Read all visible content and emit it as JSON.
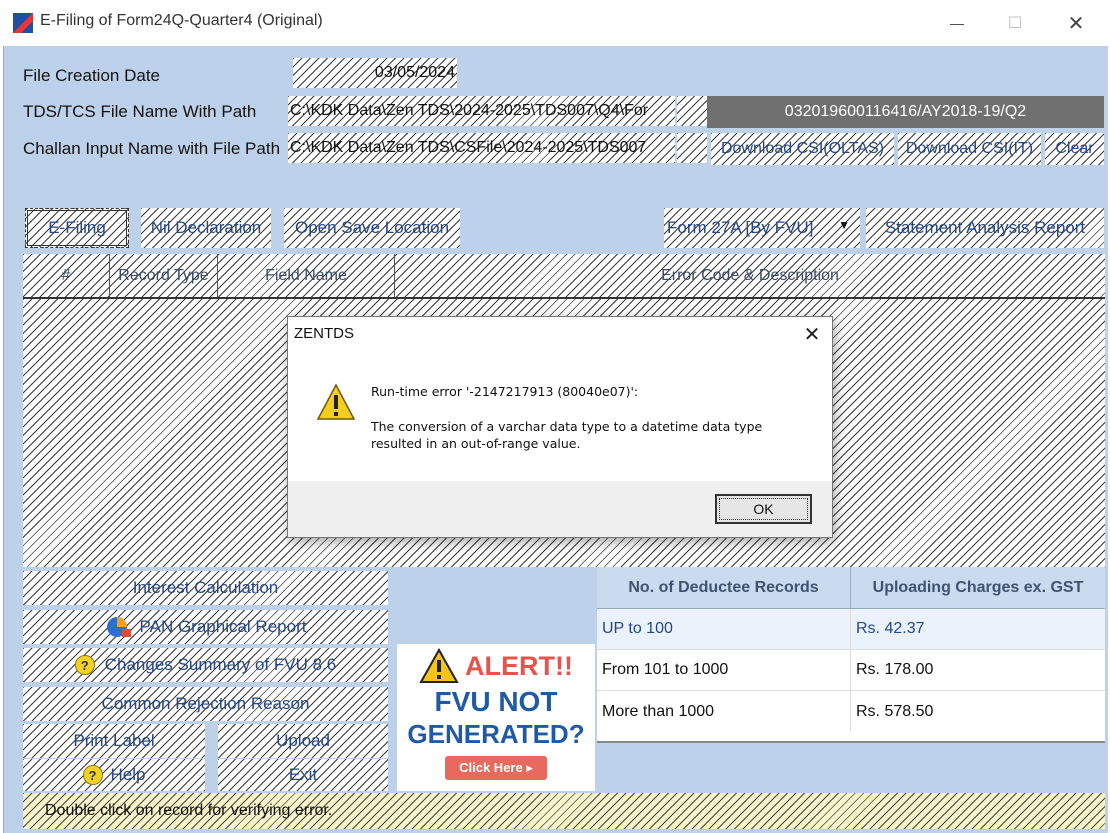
{
  "window": {
    "title": "E-Filing of Form24Q-Quarter4 (Original)",
    "minimize_glyph": "—",
    "maximize_glyph": "☐",
    "close_glyph": "✕"
  },
  "form": {
    "file_creation_date_label": "File Creation Date",
    "file_creation_date_value": "03/05/2024",
    "tds_file_label": "TDS/TCS File Name With Path",
    "tds_file_value": "C:\\KDK Data\\Zen TDS\\2024-2025\\TDS007\\Q4\\For",
    "receipt_value": "032019600116416/AY2018-19/Q2",
    "challan_label": "Challan Input Name with File Path",
    "challan_value": "C:\\KDK Data\\Zen TDS\\CSFile\\2024-2025\\TDS007",
    "download_csi_oltas": "Download CSI(OLTAS)",
    "download_csi_it": "Download CSI(IT)",
    "clear": "Clear"
  },
  "toolbar": {
    "efiling": "E-Filing",
    "nil_declaration": "Nil Declaration",
    "open_save_location": "Open Save Location",
    "form27a_selected": "Form 27A [By FVU]",
    "statement_analysis": "Statement Analysis Report"
  },
  "error_table": {
    "headers": [
      "#",
      "Record Type",
      "Field Name",
      "Error Code & Description"
    ]
  },
  "dialog": {
    "title": "ZENTDS",
    "line1": "Run-time error '-2147217913 (80040e07)':",
    "line2": "The conversion of a varchar data type to a datetime data type resulted in an out-of-range value.",
    "ok": "OK",
    "icon": "warning-icon"
  },
  "actions": {
    "interest_calculation": "Interest Calculation",
    "pan_graphical_report": "PAN Graphical Report",
    "changes_summary": "Changes Summary of FVU 8.6",
    "common_rejection": "Common Rejection Reason",
    "print_label": "Print Label",
    "upload": "Upload",
    "help": "Help",
    "exit": "Exit"
  },
  "alert_banner": {
    "alert": "ALERT!!",
    "line1": "FVU NOT",
    "line2": "GENERATED?",
    "click_here": "Click Here ▸"
  },
  "charges_table": {
    "headers": [
      "No. of Deductee Records",
      "Uploading Charges ex. GST"
    ],
    "rows": [
      {
        "range": "UP to 100",
        "charge": "Rs. 42.37"
      },
      {
        "range": "From 101 to 1000",
        "charge": "Rs. 178.00"
      },
      {
        "range": "More than 1000",
        "charge": "Rs. 578.50"
      }
    ]
  },
  "status_bar": "Double click on record for verifying error.",
  "colors": {
    "client_bg": "#bdd2ea",
    "link_blue": "#24468a",
    "alert_red": "#e4564b",
    "alert_blue": "#1f5aa8",
    "receipt_bg": "#707070"
  }
}
